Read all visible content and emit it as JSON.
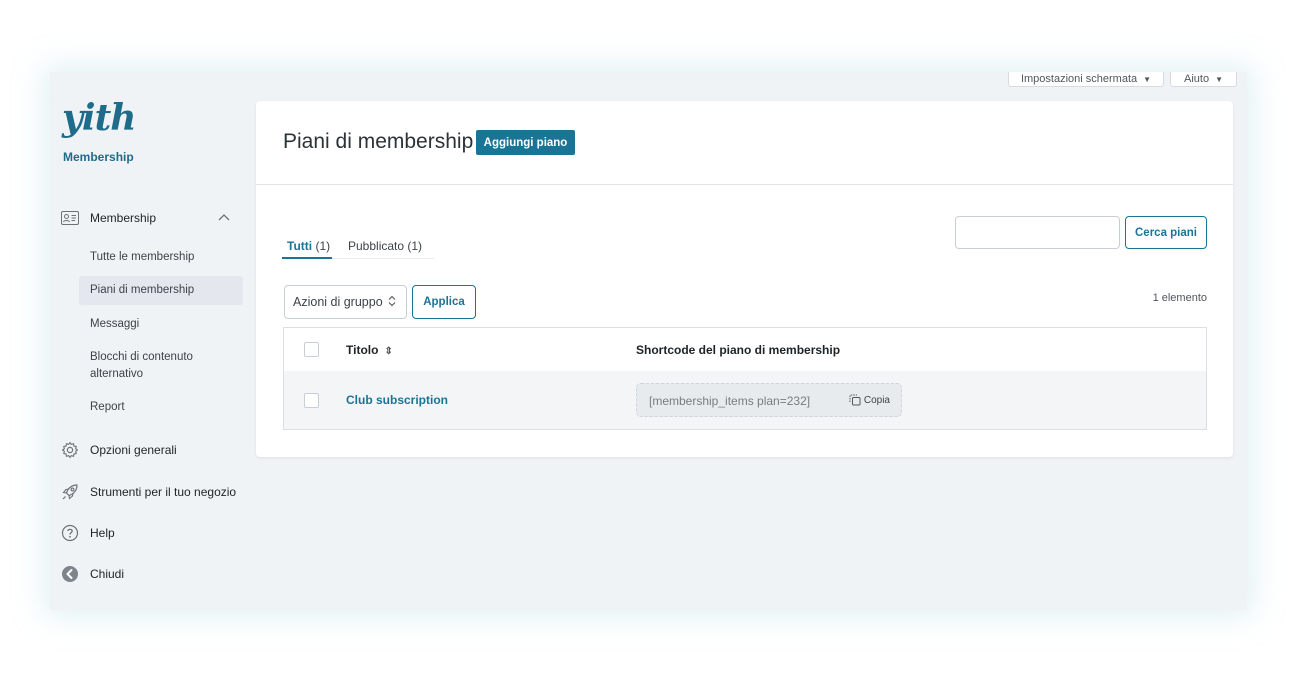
{
  "screen_options": {
    "screen_settings_label": "Impostazioni schermata",
    "help_label": "Aiuto"
  },
  "sidebar": {
    "logo_text": "yith",
    "brand_label": "Membership",
    "membership_section": {
      "label": "Membership",
      "items": [
        {
          "label": "Tutte le membership"
        },
        {
          "label": "Piani di membership"
        },
        {
          "label": "Messaggi"
        },
        {
          "label": "Blocchi di contenuto alternativo"
        },
        {
          "label": "Report"
        }
      ]
    },
    "general_options": "Opzioni generali",
    "shop_tools": "Strumenti per il tuo negozio",
    "help": "Help",
    "close": "Chiudi"
  },
  "main": {
    "title": "Piani di membership",
    "add_button": "Aggiungi piano",
    "tabs": [
      {
        "label": "Tutti",
        "count": "(1)"
      },
      {
        "label": "Pubblicato",
        "count": "(1)"
      }
    ],
    "search_value": "",
    "search_button": "Cerca piani",
    "bulk_actions": "Azioni di gruppo",
    "apply_button": "Applica",
    "items_count": "1 elemento",
    "table": {
      "columns": [
        "Titolo",
        "Shortcode del piano di membership"
      ],
      "rows": [
        {
          "title": "Club subscription",
          "shortcode": "[membership_items plan=232]",
          "copy_label": "Copia"
        }
      ]
    }
  },
  "colors": {
    "accent": "#1a7496",
    "brand": "#1f6b8a",
    "background": "#f0f3f6"
  }
}
